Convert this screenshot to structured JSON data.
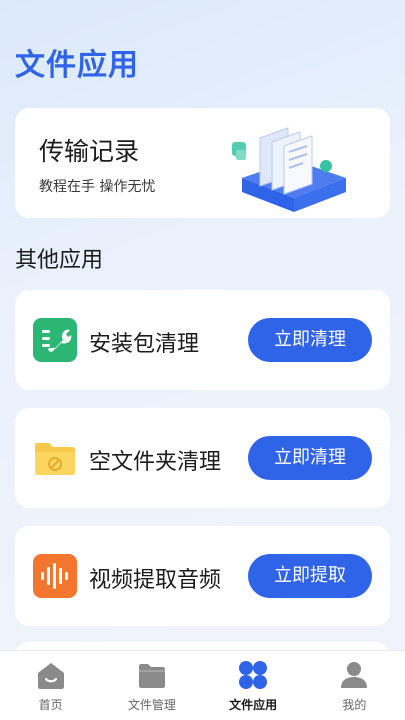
{
  "header": {
    "title": "文件应用"
  },
  "hero": {
    "title": "传输记录",
    "subtitle": "教程在手 操作无忧"
  },
  "section": {
    "title": "其他应用"
  },
  "apps": [
    {
      "label": "安装包清理",
      "button": "立即清理",
      "icon": "wrench-icon",
      "color": "#2bb673"
    },
    {
      "label": "空文件夹清理",
      "button": "立即清理",
      "icon": "folder-icon",
      "color": "#f7c948"
    },
    {
      "label": "视频提取音频",
      "button": "立即提取",
      "icon": "audio-wave-icon",
      "color": "#f2762e"
    }
  ],
  "tabbar": {
    "items": [
      {
        "label": "首页",
        "icon": "home-icon"
      },
      {
        "label": "文件管理",
        "icon": "folder-icon"
      },
      {
        "label": "文件应用",
        "icon": "grid-icon",
        "active": true
      },
      {
        "label": "我的",
        "icon": "user-icon"
      }
    ]
  },
  "colors": {
    "accent": "#2f63e8",
    "inactive_icon": "#8a8a8a"
  }
}
